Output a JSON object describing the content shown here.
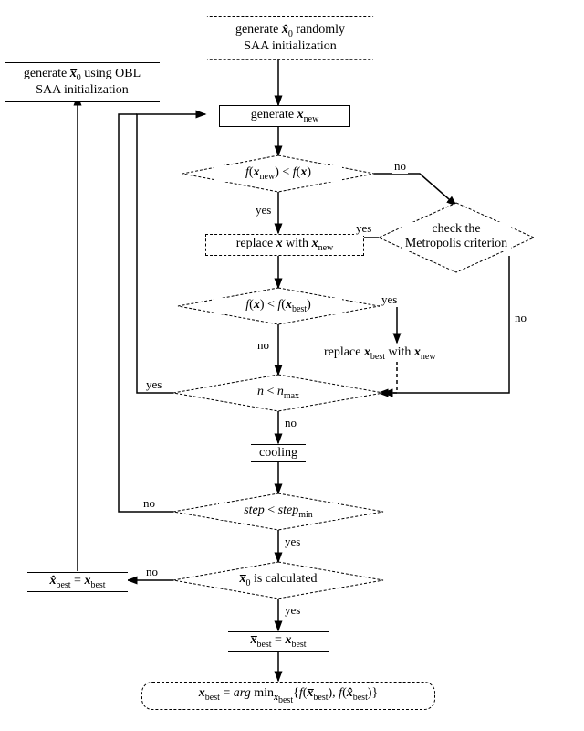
{
  "nodes": {
    "start": "generate <span class='bital'>x&#770;</span><sub>0</sub> randomly<br>SAA initialization",
    "obl": "generate <span class='bital'>x&#773;</span><sub>0</sub> using OBL<br>SAA initialization",
    "gen_xnew": "generate <span class='bital'>x</span><sub>new</sub>",
    "cmp_fnew": "<span class='ital'>f</span>(<span class='bital'>x</span><sub>new</sub>) &lt; <span class='ital'>f</span>(<span class='bital'>x</span>)",
    "metro": "check the<br>Metropolis criterion",
    "replace_x": "replace <span class='bital'>x</span> with <span class='bital'>x</span><sub>new</sub>",
    "cmp_fbest": "<span class='ital'>f</span>(<span class='bital'>x</span>) &lt; <span class='ital'>f</span>(<span class='bital'>x</span><sub>best</sub>)",
    "replace_best": "replace <span class='bital'>x</span><sub>best</sub> with <span class='bital'>x</span><sub>new</sub>",
    "cmp_n": "<span class='ital'>n</span> &lt; <span class='ital'>n</span><sub>max</sub>",
    "cooling": "cooling",
    "cmp_step": "<span class='ital'>step</span> &lt; <span class='ital'>step</span><sub>min</sub>",
    "calc_xbar": "<span class='bital'>x&#773;</span><sub>0</sub> is calculated",
    "hat_eq": "<span class='bital'>x&#770;</span><sub>best</sub> = <span class='bital'>x</span><sub>best</sub>",
    "bar_eq": "<span class='bital'>x&#773;</span><sub>best</sub> = <span class='bital'>x</span><sub>best</sub>",
    "final": "<span class='bital'>x</span><sub>best</sub> = <span class='ital'>arg</span> min<sub><span class='bital'>x</span><sub>best</sub></sub>{<span class='ital'>f</span>(<span class='bital'>x&#773;</span><sub>best</sub>), <span class='ital'>f</span>(<span class='bital'>x&#770;</span><sub>best</sub>)}"
  },
  "labels": {
    "yes": "yes",
    "no": "no"
  },
  "chart_data": {
    "type": "diagram",
    "description": "Flowchart of a simulated annealing algorithm (SAA) with Opposition-Based Learning (OBL) initialization.",
    "edges": [
      [
        "start",
        "gen_xnew",
        ""
      ],
      [
        "gen_xnew",
        "cmp_fnew",
        ""
      ],
      [
        "cmp_fnew",
        "replace_x",
        "yes"
      ],
      [
        "cmp_fnew",
        "metro",
        "no"
      ],
      [
        "metro",
        "replace_x",
        "yes"
      ],
      [
        "metro",
        "cmp_n",
        "no"
      ],
      [
        "replace_x",
        "cmp_fbest",
        ""
      ],
      [
        "cmp_fbest",
        "replace_best",
        "yes"
      ],
      [
        "cmp_fbest",
        "cmp_n",
        "no"
      ],
      [
        "replace_best",
        "cmp_n",
        ""
      ],
      [
        "cmp_n",
        "gen_xnew",
        "yes"
      ],
      [
        "cmp_n",
        "cooling",
        "no"
      ],
      [
        "cooling",
        "cmp_step",
        ""
      ],
      [
        "cmp_step",
        "gen_xnew",
        "no"
      ],
      [
        "cmp_step",
        "calc_xbar",
        "yes"
      ],
      [
        "calc_xbar",
        "hat_eq",
        "no"
      ],
      [
        "hat_eq",
        "obl",
        ""
      ],
      [
        "obl",
        "gen_xnew",
        ""
      ],
      [
        "calc_xbar",
        "bar_eq",
        "yes"
      ],
      [
        "bar_eq",
        "final",
        ""
      ]
    ]
  }
}
